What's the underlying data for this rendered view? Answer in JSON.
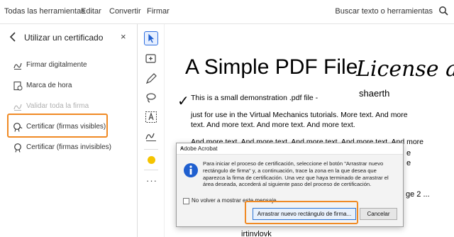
{
  "topbar": {
    "menu": [
      "Todas las herramientas",
      "Editar",
      "Convertir",
      "Firmar"
    ],
    "search_text": "Buscar texto o herramientas",
    "search_icon": "search-icon"
  },
  "panel": {
    "title": "Utilizar un certificado",
    "close": "×",
    "items": [
      {
        "label": "Firmar digitalmente",
        "icon": "sign-digital-icon"
      },
      {
        "label": "Marca de hora",
        "icon": "timestamp-icon"
      },
      {
        "label": "Validar toda la firma",
        "icon": "validate-signature-icon"
      },
      {
        "label": "Certificar (firmas visibles)",
        "icon": "certify-visible-icon"
      },
      {
        "label": "Certificar (firmas invisibles)",
        "icon": "certify-invisible-icon"
      }
    ]
  },
  "rail": {
    "tools": [
      "select-pointer-icon",
      "add-comment-icon",
      "pen-icon",
      "lasso-icon",
      "text-field-icon",
      "signature-icon"
    ],
    "highlight_color": "#f5c400",
    "more": "···"
  },
  "document": {
    "title": "A Simple PDF File",
    "script_text": "License a",
    "shaerth": "shaerth",
    "lines": [
      "This is a small demonstration .pdf file -",
      "just for use in the Virtual Mechanics tutorials. More text. And more",
      "text. And more text. And more text. And more text.",
      "And more text. And more text. And more text. And more text. And more"
    ],
    "frag_s1": "e",
    "frag_s2": "e",
    "frag_page2": "ge 2 ...",
    "frag_bottom": "irtinvlovk"
  },
  "dialog": {
    "title": "Adobe Acrobat",
    "close": "×",
    "message": "Para iniciar el proceso de certificación, seleccione el botón \"Arrastrar nuevo rectángulo de firma\" y, a continuación, trace la zona en la que desea que aparezca la firma de certificación. Una vez que haya terminado de arrastrar el área deseada, accederá al siguiente paso del proceso de certificación.",
    "checkbox_label": "No volver a mostrar este mensaje",
    "primary_button": "Arrastrar nuevo rectángulo de firma...",
    "cancel_button": "Cancelar"
  },
  "colors": {
    "highlight_outline": "#f08a24",
    "accent_blue": "#2f6fe0"
  }
}
